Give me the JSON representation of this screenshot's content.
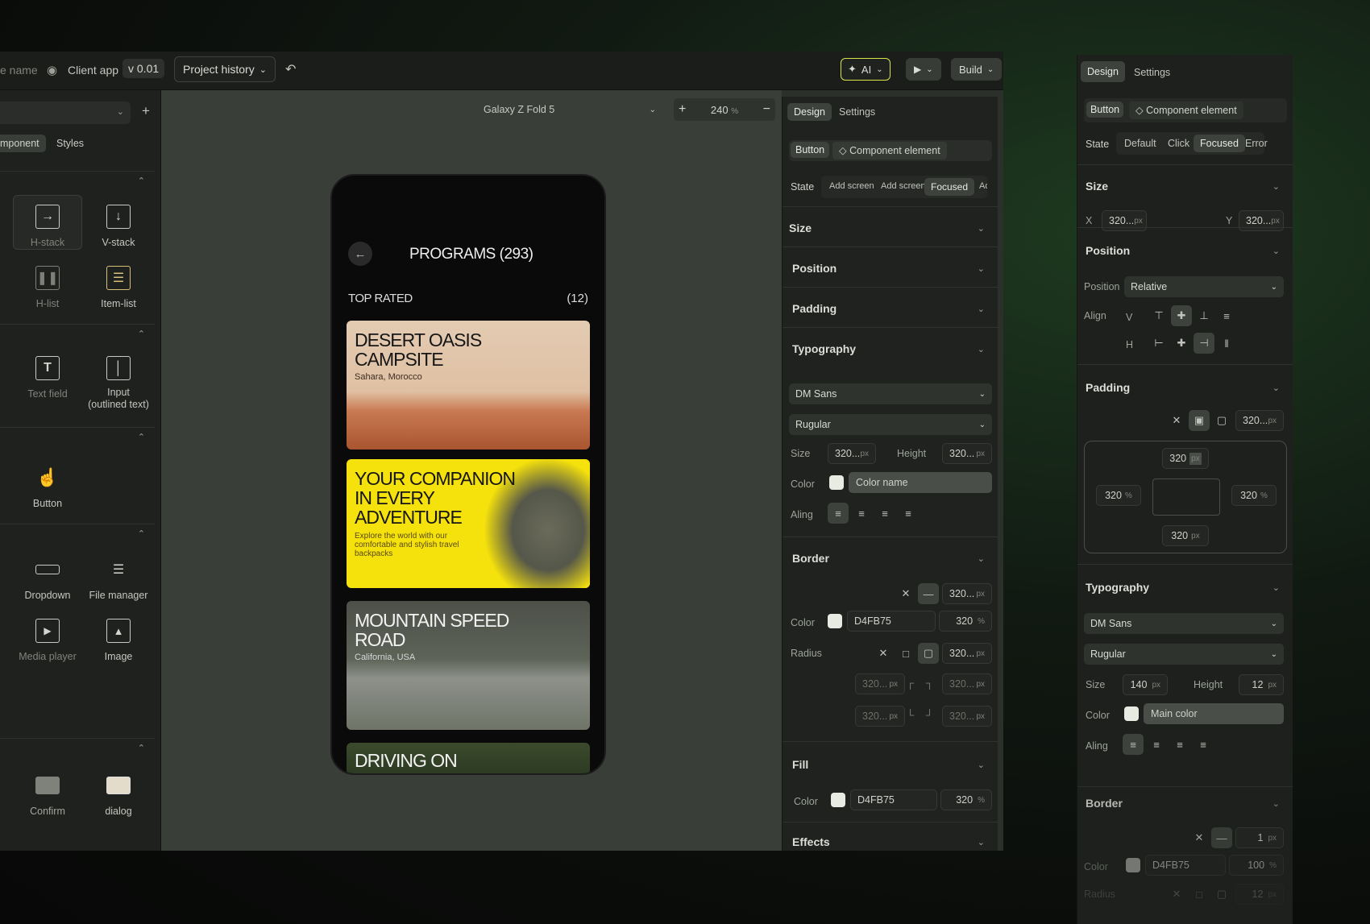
{
  "topbar": {
    "file_name": "e name",
    "app_name": "Client app",
    "version": "v 0.01",
    "project_history": "Project history",
    "ai": "AI",
    "build": "Build"
  },
  "canvas": {
    "device": "Galaxy Z Fold 5",
    "zoom": "240",
    "zoom_unit": "%"
  },
  "left": {
    "tabs": [
      "mponent",
      "Styles"
    ],
    "components": [
      {
        "label": "H-stack",
        "icon": "h-stack-icon"
      },
      {
        "label": "V-stack",
        "icon": "v-stack-icon"
      },
      {
        "label": "H-list",
        "icon": "h-list-icon"
      },
      {
        "label": "Item-list",
        "icon": "item-list-icon"
      },
      {
        "label": "Text field",
        "icon": "text-field-icon"
      },
      {
        "label": "Input\n(outlined text)",
        "icon": "input-icon"
      },
      {
        "label": "Button",
        "icon": "button-icon"
      },
      {
        "label": "Dropdown",
        "icon": "dropdown-icon"
      },
      {
        "label": "File manager",
        "icon": "file-manager-icon"
      },
      {
        "label": "Media player",
        "icon": "media-player-icon"
      },
      {
        "label": "Image",
        "icon": "image-icon"
      },
      {
        "label": "Confirm",
        "icon": "confirm-icon"
      },
      {
        "label": "dialog",
        "icon": "dialog-icon"
      }
    ]
  },
  "phone": {
    "title": "PROGRAMS (293)",
    "section": "TOP RATED",
    "count": "(12)",
    "cards": [
      {
        "title": "DESERT OASIS CAMPSITE",
        "subtitle": "Sahara, Morocco"
      },
      {
        "title": "YOUR COMPANION IN EVERY ADVENTURE",
        "subtitle": "Explore the world with our comfortable and stylish travel backpacks"
      },
      {
        "title": "MOUNTAIN SPEED ROAD",
        "subtitle": "California, USA"
      },
      {
        "title": "DRIVING ON",
        "subtitle": ""
      }
    ]
  },
  "mid": {
    "tabs": [
      "Design",
      "Settings"
    ],
    "element": "Button",
    "element_type": "Component element",
    "state_label": "State",
    "states": [
      "Add screen",
      "Add screen",
      "Focused",
      "Ad"
    ],
    "sections": {
      "size": "Size",
      "position": "Position",
      "padding": "Padding",
      "typography": "Typography",
      "border": "Border",
      "fill": "Fill",
      "effects": "Effects"
    },
    "font": "DM Sans",
    "weight": "Rugular",
    "size_label": "Size",
    "size_val": "320...",
    "height_label": "Height",
    "height_val": "320...",
    "px": "px",
    "color_label": "Color",
    "color_name": "Color name",
    "align_label": "Aling",
    "border_val": "320...",
    "border_color": "D4FB75",
    "border_pct": "320",
    "pct": "%",
    "radius_label": "Radius",
    "radius_val": "320...",
    "corner_val": "320...",
    "fill_color": "D4FB75",
    "fill_pct": "320"
  },
  "right": {
    "tabs": [
      "Design",
      "Settings"
    ],
    "element": "Button",
    "element_type": "Component element",
    "state_label": "State",
    "states": [
      "Default",
      "Click",
      "Focused",
      "Error"
    ],
    "sections": {
      "size": "Size",
      "position": "Position",
      "padding": "Padding",
      "typography": "Typography",
      "border": "Border"
    },
    "x_label": "X",
    "x_val": "320...",
    "y_label": "Y",
    "y_val": "320...",
    "px": "px",
    "position_label": "Position",
    "position_val": "Relative",
    "align_label": "Align",
    "v": "V",
    "h": "H",
    "padding_val": "320...",
    "pad_top": "320",
    "pad_left": "320",
    "pad_right": "320",
    "pad_bottom": "320",
    "pct": "%",
    "font": "DM Sans",
    "weight": "Rugular",
    "size_label": "Size",
    "size_val": "140",
    "height_label": "Height",
    "height_val": "12",
    "color_label": "Color",
    "color_name": "Main color",
    "aling_label": "Aling",
    "border_val": "1",
    "border_color_label": "Color",
    "border_color": "D4FB75",
    "border_pct": "100",
    "radius_label": "Radius",
    "radius_val": "12"
  }
}
